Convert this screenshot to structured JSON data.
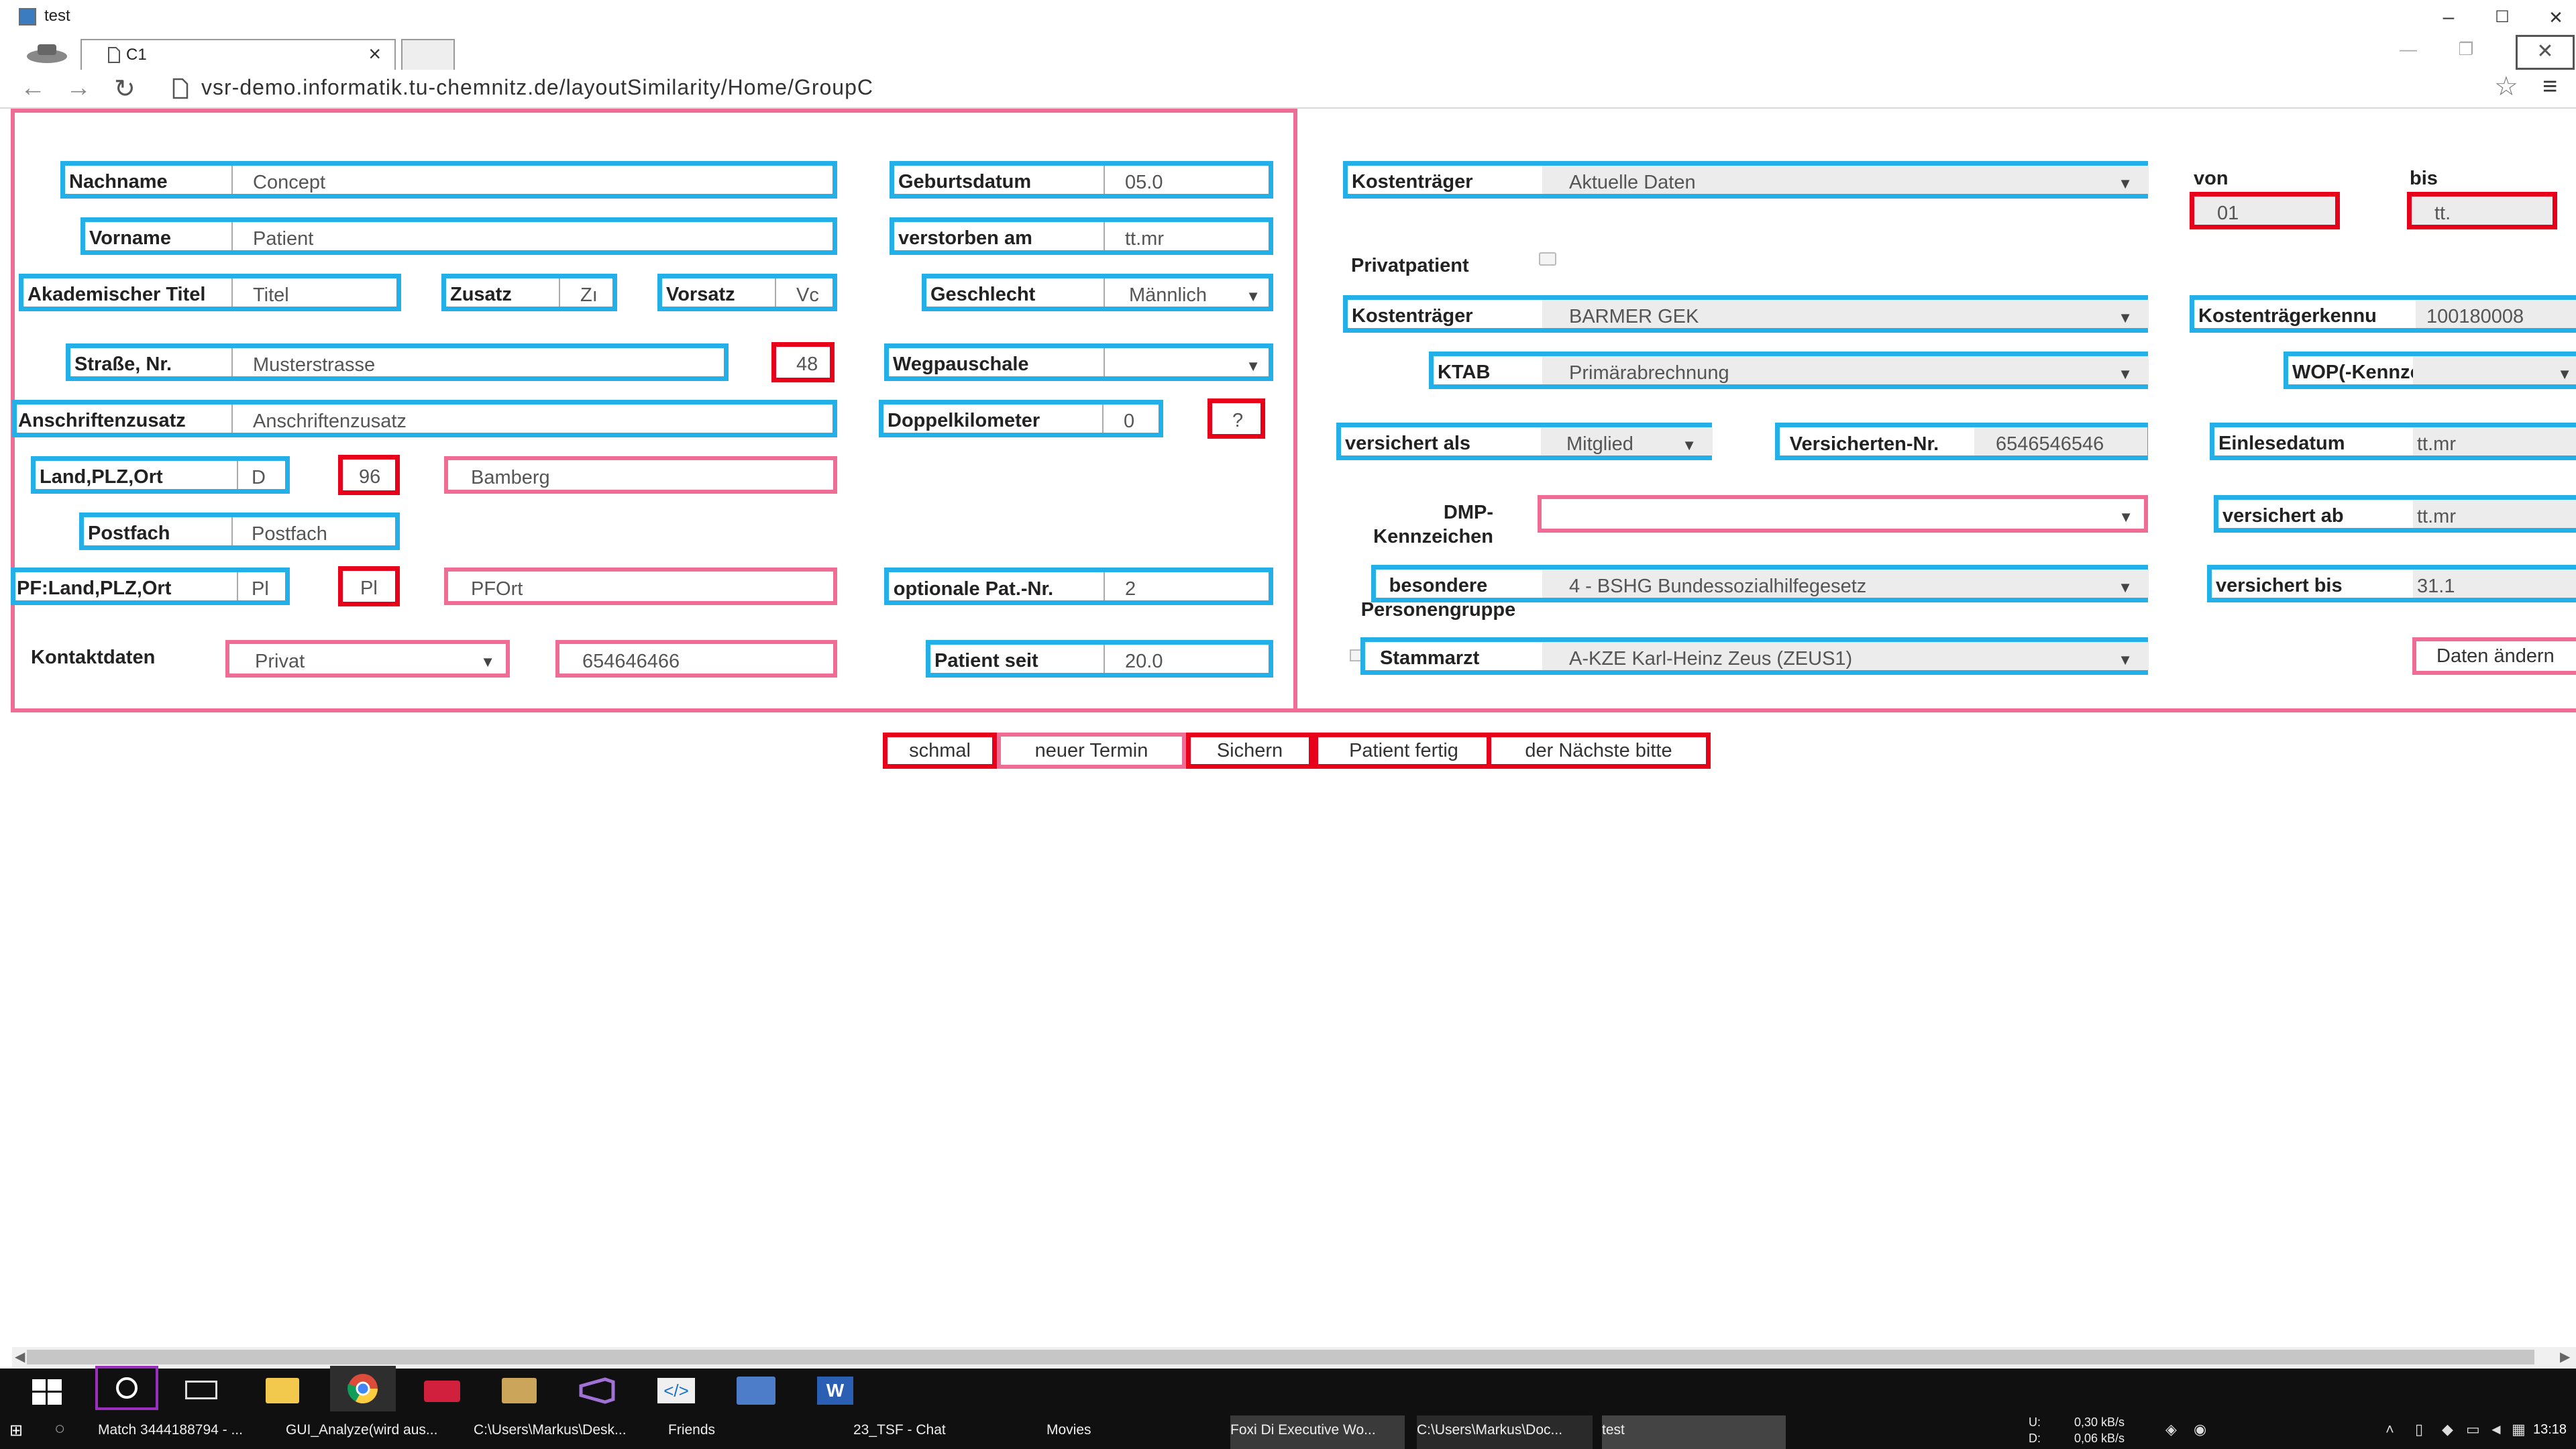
{
  "window": {
    "title": "test",
    "minimize": "–",
    "maximize": "☐",
    "close": "✕"
  },
  "browser": {
    "tab_label": "C1",
    "tab_close": "×",
    "url": "vsr-demo.informatik.tu-chemnitz.de/layoutSimilarity/Home/GroupC"
  },
  "left_form": {
    "nachname": {
      "label": "Nachname",
      "value": "Concept"
    },
    "vorname": {
      "label": "Vorname",
      "value": "Patient"
    },
    "akademischer_titel": {
      "label": "Akademischer Titel",
      "value": "Titel"
    },
    "zusatz": {
      "label": "Zusatz",
      "value": "Zı"
    },
    "vorsatz": {
      "label": "Vorsatz",
      "value": "Vc"
    },
    "strasse": {
      "label": "Straße, Nr.",
      "value": "Musterstrasse",
      "nr": "48"
    },
    "anschriftenzusatz": {
      "label": "Anschriftenzusatz",
      "value": "Anschriftenzusatz"
    },
    "land_plz_ort": {
      "label": "Land,PLZ,Ort",
      "land": "D",
      "plz": "96",
      "ort": "Bamberg"
    },
    "postfach": {
      "label": "Postfach",
      "value": "Postfach"
    },
    "pf_land_plz_ort": {
      "label": "PF:Land,PLZ,Ort",
      "land": "Pl",
      "plz": "Pl",
      "ort": "PFOrt"
    },
    "kontaktdaten": {
      "label": "Kontaktdaten",
      "type": "Privat",
      "value": "654646466"
    }
  },
  "mid_form": {
    "geburtsdatum": {
      "label": "Geburtsdatum",
      "value": "05.0"
    },
    "verstorben": {
      "label": "verstorben am",
      "value": "tt.mr"
    },
    "geschlecht": {
      "label": "Geschlecht",
      "value": "Männlich"
    },
    "wegpauschale": {
      "label": "Wegpauschale",
      "value": ""
    },
    "doppelkilometer": {
      "label": "Doppelkilometer",
      "value": "0",
      "help": "?"
    },
    "optionale_pat_nr": {
      "label": "optionale Pat.-Nr.",
      "value": "2"
    },
    "patient_seit": {
      "label": "Patient seit",
      "value": "20.0"
    }
  },
  "right_form": {
    "kostentraeger1": {
      "label": "Kostenträger",
      "value": "Aktuelle Daten"
    },
    "von": {
      "label": "von",
      "value": "01"
    },
    "bis": {
      "label": "bis",
      "value": "tt."
    },
    "privatpatient": {
      "label": "Privatpatient"
    },
    "kostentraeger2": {
      "label": "Kostenträger",
      "value": "BARMER GEK"
    },
    "kostentraegerkennung": {
      "label": "Kostenträgerkennu",
      "value": "100180008"
    },
    "ktab": {
      "label": "KTAB",
      "value": "Primärabrechnung"
    },
    "wop": {
      "label": "WOP(-Kennzeichen)",
      "value": ""
    },
    "versichert_als": {
      "label": "versichert als",
      "value": "Mitglied"
    },
    "versicherten_nr": {
      "label": "Versicherten-Nr.",
      "value": "6546546546"
    },
    "einlesedatum": {
      "label": "Einlesedatum",
      "value": "tt.mr"
    },
    "dmp": {
      "label": "DMP-Kennzeichen",
      "value": ""
    },
    "versichert_ab": {
      "label": "versichert ab",
      "value": "tt.mr"
    },
    "personengruppe": {
      "label": "besondere Personengruppe",
      "value": "4 - BSHG Bundessozialhilfegesetz"
    },
    "versichert_bis": {
      "label": "versichert bis",
      "value": "31.1"
    },
    "stammarzt": {
      "label": "Stammarzt",
      "value": "A-KZE Karl-Heinz Zeus (ZEUS1)"
    },
    "daten_aendern": "Daten ändern"
  },
  "actions": {
    "schmal": "schmal",
    "neuer_termin": "neuer Termin",
    "sichern": "Sichern",
    "patient_fertig": "Patient fertig",
    "naechste": "der Nächste bitte"
  },
  "taskbar": {
    "tasks": [
      "Match 3444188794 - ...",
      "GUI_Analyze(wird aus...",
      "C:\\Users\\Markus\\Desk...",
      "Friends",
      "23_TSF - Chat",
      "Movies",
      "Foxi Di Executive Wo...",
      "C:\\Users\\Markus\\Doc...",
      "test"
    ],
    "net_up_label": "U:",
    "net_down_label": "D:",
    "net_up": "0,30 kB/s",
    "net_down": "0,06 kB/s",
    "clock": "13:18"
  }
}
